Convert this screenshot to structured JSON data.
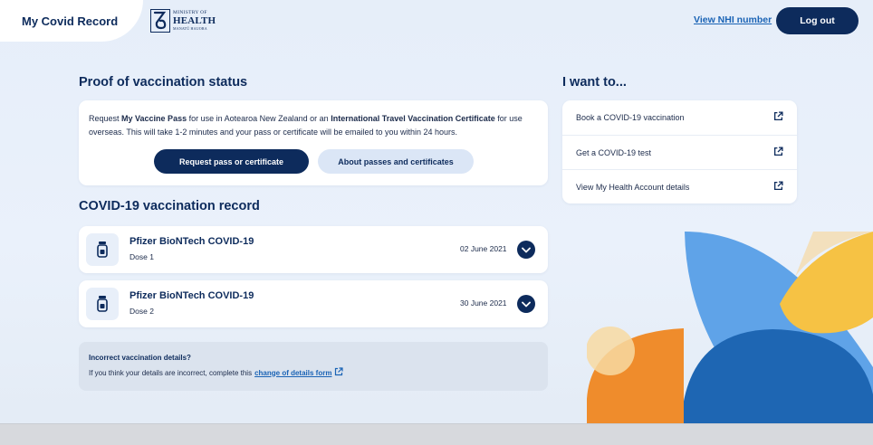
{
  "header": {
    "app_title": "My Covid Record",
    "logo": {
      "line1": "MINISTRY OF",
      "line2": "HEALTH",
      "line3": "MANATŪ HAUORA"
    },
    "nhi_link": "View NHI number",
    "logout_label": "Log out"
  },
  "proof": {
    "heading": "Proof of vaccination status",
    "text_request": "Request ",
    "text_pass": "My Vaccine Pass",
    "text_mid": " for use in Aotearoa New Zealand or an ",
    "text_itvc": "International Travel Vaccination Certificate",
    "text_end": " for use overseas. This will take 1-2 minutes and your pass or certificate will be emailed to you within 24 hours.",
    "primary_button": "Request pass or certificate",
    "secondary_button": "About passes and certificates"
  },
  "record": {
    "heading": "COVID-19 vaccination record",
    "doses": [
      {
        "name": "Pfizer BioNTech COVID-19",
        "dose": "Dose 1",
        "date": "02 June 2021"
      },
      {
        "name": "Pfizer BioNTech COVID-19",
        "dose": "Dose 2",
        "date": "30 June 2021"
      }
    ]
  },
  "incorrect": {
    "title": "Incorrect vaccination details?",
    "text": "If you think your details are incorrect, complete this",
    "link": "change of details form"
  },
  "want_to": {
    "heading": "I want to...",
    "items": [
      {
        "label": "Book a COVID-19 vaccination",
        "icon": "external-link-icon"
      },
      {
        "label": "Get a COVID-19 test",
        "icon": "external-link-icon"
      },
      {
        "label": "View My Health Account details",
        "icon": "external-link-icon"
      }
    ]
  },
  "colors": {
    "navy": "#0d2b5c",
    "link_blue": "#1a63b5",
    "secondary_button_bg": "#dbe6f6",
    "decor_blue_light": "#5fa3e8",
    "decor_blue_dark": "#1e66b3",
    "decor_yellow": "#f6c244",
    "decor_orange": "#ef8c2c",
    "decor_peach": "#f7d9a2"
  }
}
